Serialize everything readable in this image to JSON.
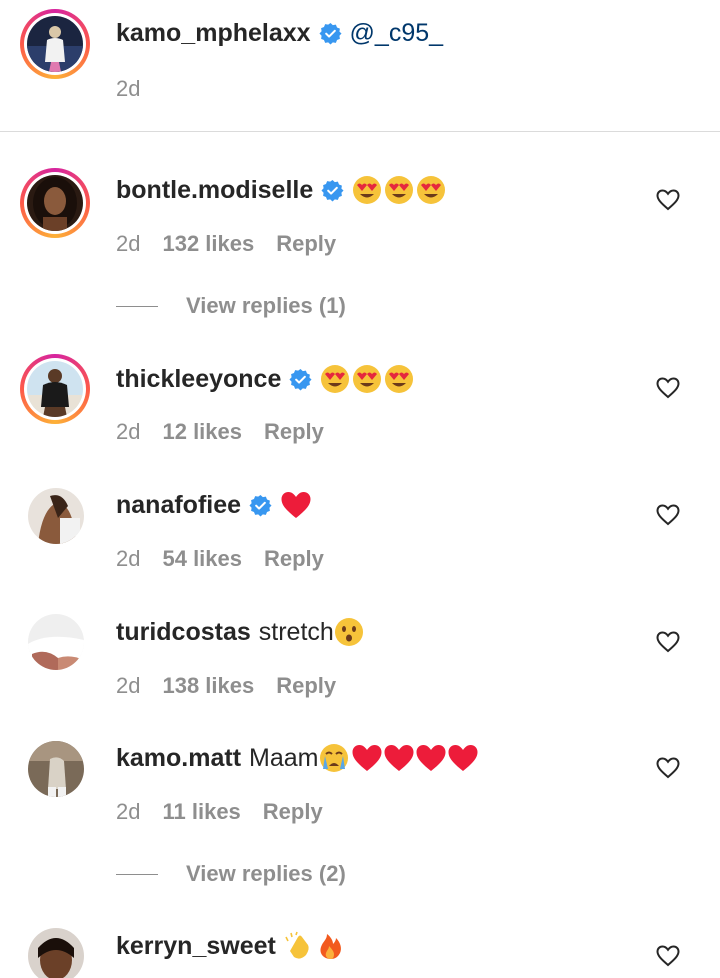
{
  "caption": {
    "username": "kamo_mphelaxx",
    "mention": "@_c95_",
    "age": "2d"
  },
  "comments": [
    {
      "username": "bontle.modiselle",
      "text": "",
      "emoji": "😍😍😍",
      "age": "2d",
      "likes": "132 likes",
      "reply": "Reply",
      "view_replies": "View replies (1)"
    },
    {
      "username": "thickleeyonce",
      "text": "",
      "emoji": "😍😍😍",
      "age": "2d",
      "likes": "12 likes",
      "reply": "Reply"
    },
    {
      "username": "nanafofiee",
      "text": "",
      "emoji": "❤️",
      "age": "2d",
      "likes": "54 likes",
      "reply": "Reply"
    },
    {
      "username": "turidcostas",
      "text": "stretch",
      "emoji": "😯",
      "age": "2d",
      "likes": "138 likes",
      "reply": "Reply"
    },
    {
      "username": "kamo.matt",
      "text": "Maam",
      "emoji": "😭❤️❤️❤️❤️",
      "age": "2d",
      "likes": "11 likes",
      "reply": "Reply",
      "view_replies": "View replies (2)"
    },
    {
      "username": "kerryn_sweet",
      "text": "",
      "emoji": "👏🔥"
    }
  ],
  "icons": {
    "verified": "verified-badge-icon",
    "like": "heart-outline-icon"
  },
  "colors": {
    "verified_blue": "#3897f0",
    "meta_gray": "#8e8e8e",
    "divider": "#dbdbdb",
    "heart_red": "#ed1c3a"
  }
}
